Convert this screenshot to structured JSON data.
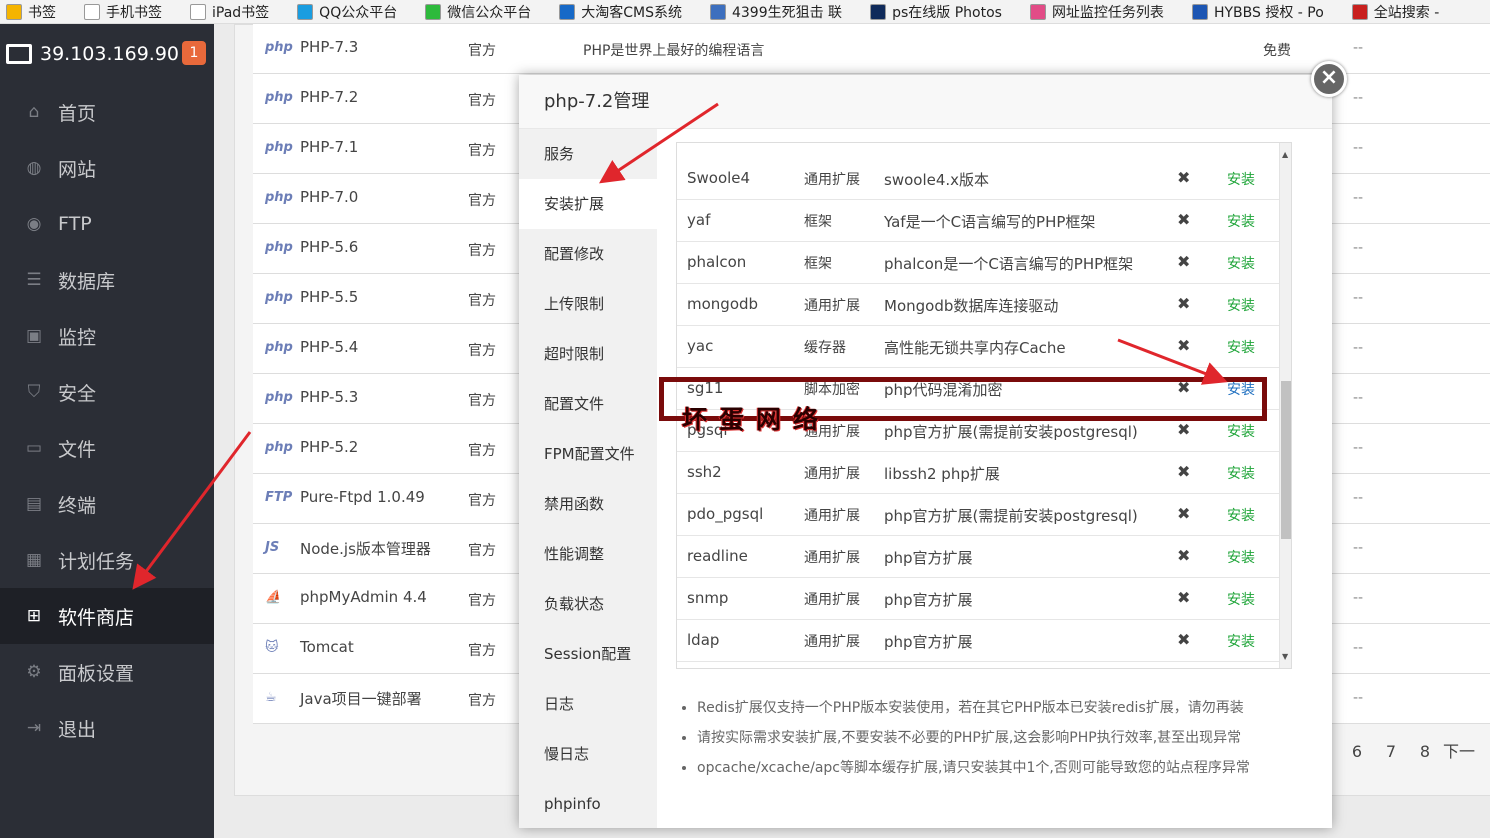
{
  "bookmarks": [
    {
      "label": "书签",
      "color": "#f5b400"
    },
    {
      "label": "手机书签",
      "color": "#ffffff"
    },
    {
      "label": "iPad书签",
      "color": "#ffffff"
    },
    {
      "label": "QQ公众平台",
      "color": "#1a9de0"
    },
    {
      "label": "微信公众平台",
      "color": "#2dba3c"
    },
    {
      "label": "大淘客CMS系统",
      "color": "#1769c7"
    },
    {
      "label": "4399生死狙击 联",
      "color": "#3d6fbe"
    },
    {
      "label": "ps在线版 Photos",
      "color": "#0f2a5a"
    },
    {
      "label": "网址监控任务列表",
      "color": "#e24c87"
    },
    {
      "label": "HYBBS 授权 - Po",
      "color": "#1d56b3"
    },
    {
      "label": "全站搜索 - ",
      "color": "#c8201e"
    }
  ],
  "server": {
    "ip": "39.103.169.90",
    "badge": "1"
  },
  "nav": [
    {
      "label": "首页",
      "icon": "home-icon",
      "glyph": "⌂"
    },
    {
      "label": "网站",
      "icon": "globe-icon",
      "glyph": "◍"
    },
    {
      "label": "FTP",
      "icon": "ftp-icon",
      "glyph": "◉"
    },
    {
      "label": "数据库",
      "icon": "database-icon",
      "glyph": "☰"
    },
    {
      "label": "监控",
      "icon": "monitor-icon",
      "glyph": "▣"
    },
    {
      "label": "安全",
      "icon": "shield-icon",
      "glyph": "⛉"
    },
    {
      "label": "文件",
      "icon": "folder-icon",
      "glyph": "▭"
    },
    {
      "label": "终端",
      "icon": "terminal-icon",
      "glyph": "▤"
    },
    {
      "label": "计划任务",
      "icon": "calendar-icon",
      "glyph": "▦"
    },
    {
      "label": "软件商店",
      "icon": "apps-icon",
      "glyph": "⊞"
    },
    {
      "label": "面板设置",
      "icon": "gear-icon",
      "glyph": "⚙"
    },
    {
      "label": "退出",
      "icon": "logout-icon",
      "glyph": "⇥"
    }
  ],
  "software": [
    {
      "logo": "php",
      "name": "PHP-7.3",
      "type": "官方",
      "desc": "PHP是世界上最好的编程语言",
      "price": "免费",
      "extra": "--"
    },
    {
      "logo": "php",
      "name": "PHP-7.2",
      "type": "官方",
      "desc": "",
      "price": "",
      "extra": "--"
    },
    {
      "logo": "php",
      "name": "PHP-7.1",
      "type": "官方",
      "desc": "",
      "price": "",
      "extra": "--"
    },
    {
      "logo": "php",
      "name": "PHP-7.0",
      "type": "官方",
      "desc": "",
      "price": "",
      "extra": "--"
    },
    {
      "logo": "php",
      "name": "PHP-5.6",
      "type": "官方",
      "desc": "",
      "price": "",
      "extra": "--"
    },
    {
      "logo": "php",
      "name": "PHP-5.5",
      "type": "官方",
      "desc": "",
      "price": "",
      "extra": "--"
    },
    {
      "logo": "php",
      "name": "PHP-5.4",
      "type": "官方",
      "desc": "",
      "price": "",
      "extra": "--"
    },
    {
      "logo": "php",
      "name": "PHP-5.3",
      "type": "官方",
      "desc": "",
      "price": "",
      "extra": "--"
    },
    {
      "logo": "php",
      "name": "PHP-5.2",
      "type": "官方",
      "desc": "",
      "price": "",
      "extra": "--"
    },
    {
      "logo": "FTP",
      "name": "Pure-Ftpd 1.0.49",
      "type": "官方",
      "desc": "",
      "price": "",
      "extra": "--"
    },
    {
      "logo": "JS",
      "name": "Node.js版本管理器",
      "type": "官方",
      "desc": "",
      "price": "",
      "extra": "--"
    },
    {
      "logo": "⛵",
      "name": "phpMyAdmin 4.4",
      "type": "官方",
      "desc": "",
      "price": "",
      "extra": "--"
    },
    {
      "logo": "🐱",
      "name": "Tomcat",
      "type": "官方",
      "desc": "",
      "price": "",
      "extra": "--"
    },
    {
      "logo": "☕",
      "name": "Java项目一键部署",
      "type": "官方",
      "desc": "",
      "price": "",
      "extra": "--"
    }
  ],
  "pager": [
    "6",
    "7",
    "8",
    "下一"
  ],
  "modal": {
    "title": "php-7.2管理",
    "close": "×",
    "tabs": [
      "服务",
      "安装扩展",
      "配置修改",
      "上传限制",
      "超时限制",
      "配置文件",
      "FPM配置文件",
      "禁用函数",
      "性能调整",
      "负载状态",
      "Session配置",
      "日志",
      "慢日志",
      "phpinfo"
    ],
    "active_tab": "安装扩展",
    "extensions": [
      {
        "name": "Swoole4",
        "type": "通用扩展",
        "desc": "swoole4.x版本",
        "status": "✖",
        "action": "安装"
      },
      {
        "name": "yaf",
        "type": "框架",
        "desc": "Yaf是一个C语言编写的PHP框架",
        "status": "✖",
        "action": "安装"
      },
      {
        "name": "phalcon",
        "type": "框架",
        "desc": "phalcon是一个C语言编写的PHP框架",
        "status": "✖",
        "action": "安装"
      },
      {
        "name": "mongodb",
        "type": "通用扩展",
        "desc": "Mongodb数据库连接驱动",
        "status": "✖",
        "action": "安装"
      },
      {
        "name": "yac",
        "type": "缓存器",
        "desc": "高性能无锁共享内存Cache",
        "status": "✖",
        "action": "安装"
      },
      {
        "name": "sg11",
        "type": "脚本加密",
        "desc": "php代码混淆加密",
        "status": "✖",
        "action": "安装"
      },
      {
        "name": "pgsql",
        "type": "通用扩展",
        "desc": "php官方扩展(需提前安装postgresql)",
        "status": "✖",
        "action": "安装"
      },
      {
        "name": "ssh2",
        "type": "通用扩展",
        "desc": "libssh2 php扩展",
        "status": "✖",
        "action": "安装"
      },
      {
        "name": "pdo_pgsql",
        "type": "通用扩展",
        "desc": "php官方扩展(需提前安装postgresql)",
        "status": "✖",
        "action": "安装"
      },
      {
        "name": "readline",
        "type": "通用扩展",
        "desc": "php官方扩展",
        "status": "✖",
        "action": "安装"
      },
      {
        "name": "snmp",
        "type": "通用扩展",
        "desc": "php官方扩展",
        "status": "✖",
        "action": "安装"
      },
      {
        "name": "ldap",
        "type": "通用扩展",
        "desc": "php官方扩展",
        "status": "✖",
        "action": "安装"
      }
    ],
    "notes": [
      "Redis扩展仅支持一个PHP版本安装使用，若在其它PHP版本已安装redis扩展，请勿再装",
      "请按实际需求安装扩展,不要安装不必要的PHP扩展,这会影响PHP执行效率,甚至出现异常",
      "opcache/xcache/apc等脚本缓存扩展,请只安装其中1个,否则可能导致您的站点程序异常"
    ]
  },
  "watermark": "坏蛋网络",
  "colors": {
    "sidebar": "#2b2e36",
    "install": "#20a53a",
    "highlight": "#7a0b0b",
    "arrow": "#e0262c"
  }
}
